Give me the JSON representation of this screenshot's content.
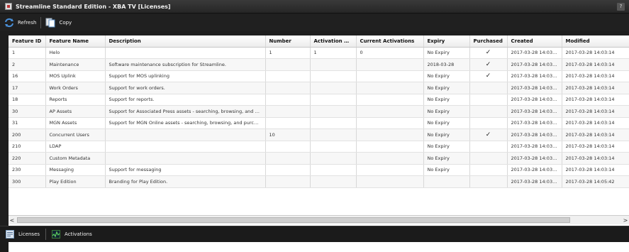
{
  "window": {
    "title": "Streamline Standard Edition - XBA TV [Licenses]",
    "help_label": "?"
  },
  "toolbar": {
    "refresh_label": "Refresh",
    "copy_label": "Copy"
  },
  "grid": {
    "columns": [
      "Feature ID",
      "Feature Name",
      "Description",
      "Number",
      "Activation Limit",
      "Current Activations",
      "Expiry",
      "Purchased",
      "Created",
      "Modified"
    ],
    "rows": [
      [
        "1",
        "Helo",
        "",
        "1",
        "1",
        "0",
        "No Expiry",
        "✓",
        "2017-03-28 14:03:14",
        "2017-03-28 14:03:14"
      ],
      [
        "2",
        "Maintenance",
        "Software maintenance subscription for Streamline.",
        "",
        "",
        "",
        "2018-03-28",
        "✓",
        "2017-03-28 14:03:14",
        "2017-03-28 14:03:14"
      ],
      [
        "16",
        "MOS Uplink",
        "Support for MOS uplinking",
        "",
        "",
        "",
        "No Expiry",
        "✓",
        "2017-03-28 14:03:14",
        "2017-03-28 14:03:14"
      ],
      [
        "17",
        "Work Orders",
        "Support for work orders.",
        "",
        "",
        "",
        "No Expiry",
        "",
        "2017-03-28 14:03:14",
        "2017-03-28 14:03:14"
      ],
      [
        "18",
        "Reports",
        "Support for reports.",
        "",
        "",
        "",
        "No Expiry",
        "",
        "2017-03-28 14:03:14",
        "2017-03-28 14:03:14"
      ],
      [
        "30",
        "AP Assets",
        "Support for Associated Press assets - searching, browsing, and pu...",
        "",
        "",
        "",
        "No Expiry",
        "",
        "2017-03-28 14:03:14",
        "2017-03-28 14:03:14"
      ],
      [
        "31",
        "MGN Assets",
        "Support for MGN Online assets - searching, browsing, and purchasi...",
        "",
        "",
        "",
        "No Expiry",
        "",
        "2017-03-28 14:03:14",
        "2017-03-28 14:03:14"
      ],
      [
        "200",
        "Concurrent Users",
        "",
        "10",
        "",
        "",
        "No Expiry",
        "✓",
        "2017-03-28 14:03:14",
        "2017-03-28 14:03:14"
      ],
      [
        "210",
        "LDAP",
        "",
        "",
        "",
        "",
        "No Expiry",
        "",
        "2017-03-28 14:03:14",
        "2017-03-28 14:03:14"
      ],
      [
        "220",
        "Custom Metadata",
        "",
        "",
        "",
        "",
        "No Expiry",
        "",
        "2017-03-28 14:03:14",
        "2017-03-28 14:03:14"
      ],
      [
        "230",
        "Messaging",
        "Support for messaging",
        "",
        "",
        "",
        "No Expiry",
        "",
        "2017-03-28 14:03:14",
        "2017-03-28 14:03:14"
      ],
      [
        "300",
        "Play Edition",
        "Branding for Play Edition.",
        "",
        "",
        "",
        "",
        "",
        "2017-03-28 14:03:14",
        "2017-03-28 14:05:42"
      ]
    ]
  },
  "scrollbar": {
    "left_arrow": "<",
    "right_arrow": ">"
  },
  "bottom_tabs": {
    "licenses_label": "Licenses",
    "activations_label": "Activations"
  },
  "colors": {
    "toolbar_bg": "#202020",
    "accent_green": "#3a7a3a",
    "grid_bg": "#ffffff"
  }
}
